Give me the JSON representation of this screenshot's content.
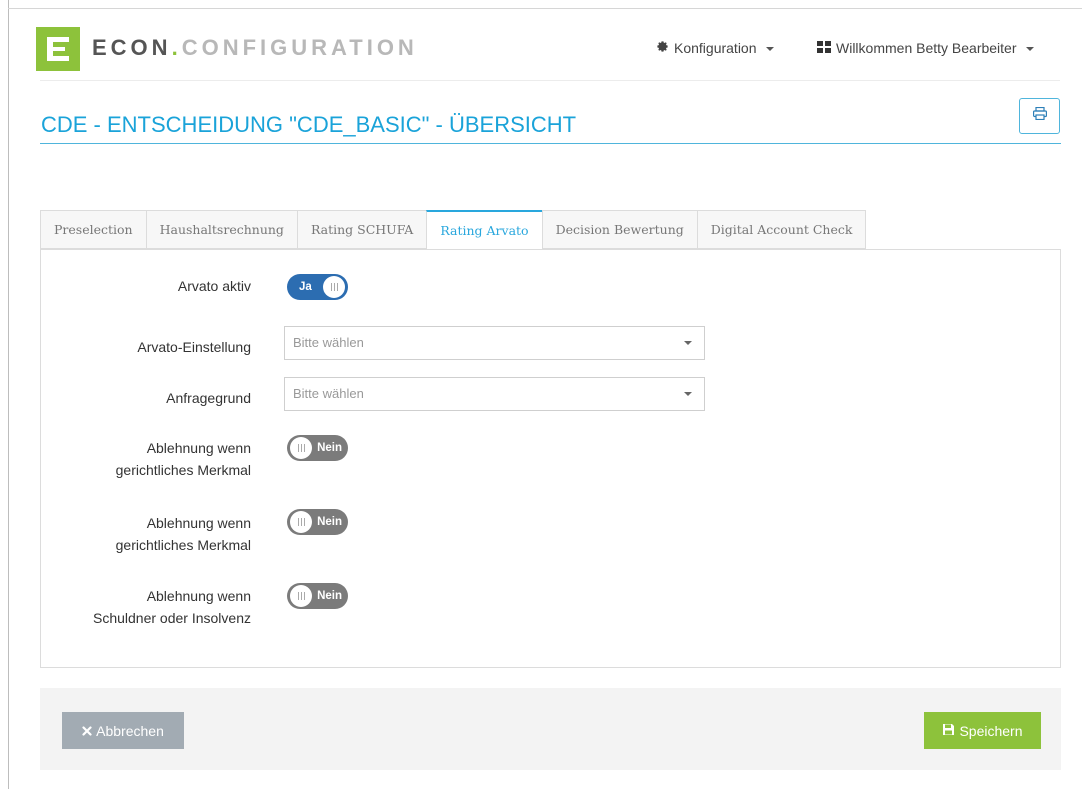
{
  "brand": {
    "part1": "ECON",
    "dot": ".",
    "part2": "CONFIGURATION",
    "logo_letter": "E"
  },
  "nav": {
    "config_label": "Konfiguration",
    "user_label": "Willkommen Betty Bearbeiter",
    "config_icon": "gear-icon",
    "user_icon": "grid-icon"
  },
  "page": {
    "title": "CDE - ENTSCHEIDUNG \"CDE_BASIC\" - ÜBERSICHT",
    "print_icon": "print-icon"
  },
  "tabs": [
    {
      "label": "Preselection",
      "active": false
    },
    {
      "label": "Haushaltsrechnung",
      "active": false
    },
    {
      "label": "Rating SCHUFA",
      "active": false
    },
    {
      "label": "Rating Arvato",
      "active": true
    },
    {
      "label": "Decision Bewertung",
      "active": false
    },
    {
      "label": "Digital Account Check",
      "active": false
    }
  ],
  "form": {
    "arvato_aktiv": {
      "label": "Arvato aktiv",
      "value": "Ja",
      "on": true
    },
    "arvato_einstellung": {
      "label": "Arvato-Einstellung",
      "value": "Bitte wählen"
    },
    "anfragegrund": {
      "label": "Anfragegrund",
      "value": "Bitte wählen"
    },
    "ablehnung_1": {
      "label_line1": "Ablehnung wenn",
      "label_line2": "gerichtliches Merkmal",
      "value": "Nein",
      "on": false
    },
    "ablehnung_2": {
      "label_line1": "Ablehnung wenn",
      "label_line2": "gerichtliches Merkmal",
      "value": "Nein",
      "on": false
    },
    "ablehnung_3": {
      "label_line1": "Ablehnung wenn",
      "label_line2": "Schuldner oder Insolvenz",
      "value": "Nein",
      "on": false
    }
  },
  "footer": {
    "cancel_label": "Abbrechen",
    "save_label": "Speichern"
  },
  "colors": {
    "accent_blue": "#1aa3d9",
    "brand_green": "#8dc23b",
    "toggle_on": "#2c6db1",
    "toggle_off": "#7b7b7b",
    "cancel_gray": "#a2abb3"
  }
}
